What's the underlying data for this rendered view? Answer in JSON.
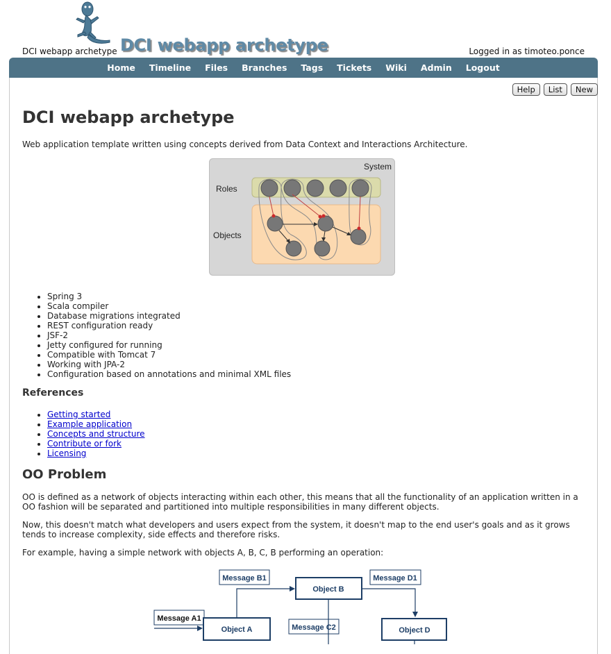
{
  "header": {
    "site_name": "DCI webapp archetype",
    "title": "DCI webapp archetype",
    "login_status": "Logged in as timoteo.ponce"
  },
  "menu": [
    "Home",
    "Timeline",
    "Files",
    "Branches",
    "Tags",
    "Tickets",
    "Wiki",
    "Admin",
    "Logout"
  ],
  "submenu": {
    "help": "Help",
    "list": "List",
    "new": "New"
  },
  "page": {
    "title": "DCI webapp archetype",
    "intro": "Web application template written using concepts derived from Data Context and Interactions Architecture.",
    "diagram": {
      "system_label": "System",
      "roles_label": "Roles",
      "objects_label": "Objects"
    },
    "features": [
      "Spring 3",
      "Scala compiler",
      "Database migrations integrated",
      "REST configuration ready",
      "JSF-2",
      "Jetty configured for running",
      "Compatible with Tomcat 7",
      "Working with JPA-2",
      "Configuration based on annotations and minimal XML files"
    ],
    "references_heading": "References",
    "references": [
      "Getting started",
      "Example application",
      "Concepts and structure",
      "Contribute or fork",
      "Licensing"
    ],
    "oo_heading": "OO Problem",
    "oo_p1": "OO is defined as a network of objects interacting within each other, this means that all the functionality of an application written in a OO fashion will be separated and partitioned into multiple responsibilities in many different objects.",
    "oo_p2": "Now, this doesn't match what developers and users expect from the system, it doesn't map to the end user's goals and as it grows tends to increase complexity, side effects and therefore risks.",
    "oo_p3": "For example, having a simple network with objects A, B, C, B performing an operation:",
    "network": {
      "message_b1": "Message B1",
      "message_d1": "Message D1",
      "message_a1": "Message A1",
      "message_c2": "Message C2",
      "object_a": "Object A",
      "object_b": "Object B",
      "object_d": "Object D"
    }
  },
  "colors": {
    "menu_bar": "#4e7387",
    "title_blue": "#5f8aa6",
    "link": "#0000cc",
    "diagram_navy": "#1d3e66"
  }
}
